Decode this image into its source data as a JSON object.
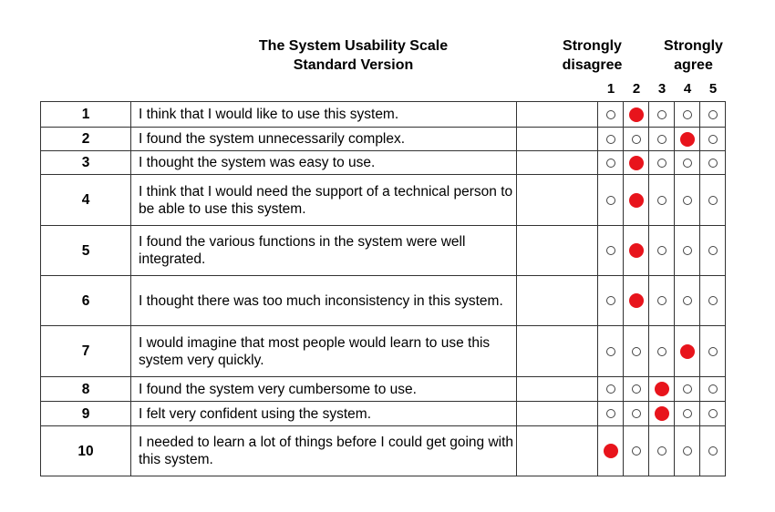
{
  "header": {
    "title_line1": "The System Usability Scale",
    "title_line2": "Standard Version",
    "disagree_line1": "Strongly",
    "disagree_line2": "disagree",
    "agree_line1": "Strongly",
    "agree_line2": "agree",
    "scale": [
      "1",
      "2",
      "3",
      "4",
      "5"
    ]
  },
  "accent_color": "#e8141c",
  "items": [
    {
      "num": "1",
      "text": "I think that I would like to use this system.",
      "selected": 2
    },
    {
      "num": "2",
      "text": "I found the system unnecessarily complex.",
      "selected": 4
    },
    {
      "num": "3",
      "text": "I thought the system was easy to use.",
      "selected": 2
    },
    {
      "num": "4",
      "text": "I think that I would need the support of a technical person to be able to use this system.",
      "selected": 2
    },
    {
      "num": "5",
      "text": "I found the various functions in the system were well integrated.",
      "selected": 2
    },
    {
      "num": "6",
      "text": "I thought there was too much inconsistency in this system.",
      "selected": 2
    },
    {
      "num": "7",
      "text": "I would imagine that most people would learn to use this system very quickly.",
      "selected": 4
    },
    {
      "num": "8",
      "text": "I found the system very cumbersome to use.",
      "selected": 3
    },
    {
      "num": "9",
      "text": "I felt very confident using the system.",
      "selected": 3
    },
    {
      "num": "10",
      "text": "I needed to learn a lot of things before I could get going with this system.",
      "selected": 1
    }
  ]
}
